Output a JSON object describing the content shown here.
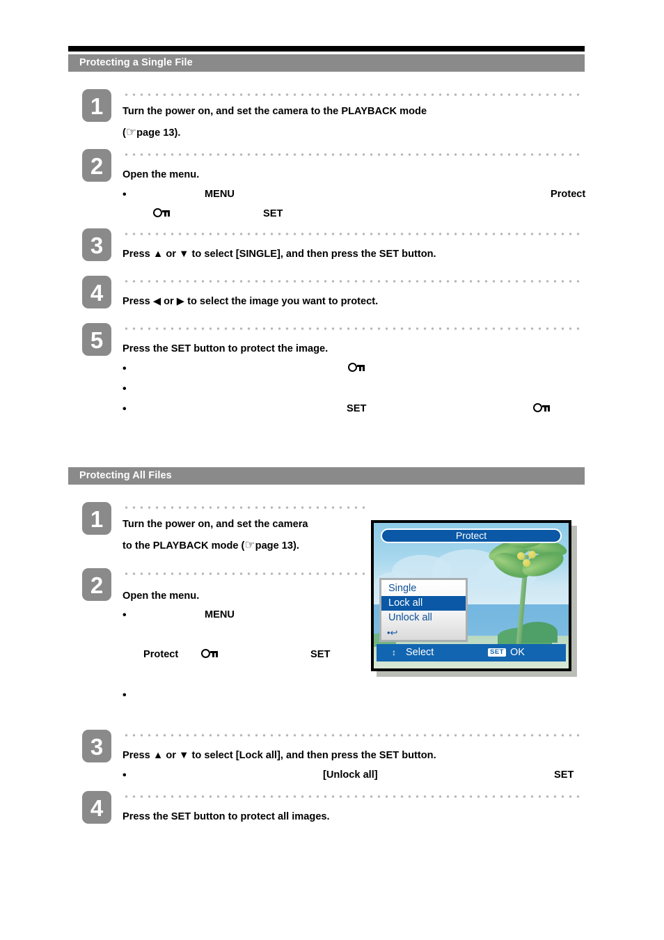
{
  "document": {
    "sections": [
      {
        "id": "single",
        "header": "Protecting a Single File",
        "has_black_rule": true,
        "steps": [
          {
            "number": "1",
            "lines": [
              "Turn the power on, and set the camera to the PLAYBACK mode",
              "page 13)."
            ],
            "line1": "Turn the power on, and set the camera to the PLAYBACK mode",
            "line2_prefix": "(",
            "line2_suffix": "page 13).",
            "bullets": []
          },
          {
            "number": "2",
            "line1": "Open the menu.",
            "bullets": [
              {
                "fragments": [
                  "MENU",
                  "Protect"
                ]
              },
              {
                "fragments": [
                  "SET"
                ]
              }
            ]
          },
          {
            "number": "3",
            "line1_a": "Press",
            "line1_b": "or",
            "line1_c": "to select [SINGLE], and then press the SET button.",
            "bullets": []
          },
          {
            "number": "4",
            "line1_a": "Press",
            "line1_b": "or",
            "line1_c": "to select the image you want to protect.",
            "bullets": []
          },
          {
            "number": "5",
            "line1": "Press the SET button to protect the image.",
            "bullets": [
              {
                "fragments": []
              },
              {
                "fragments": []
              },
              {
                "fragments": [
                  "SET"
                ]
              }
            ]
          }
        ]
      },
      {
        "id": "all",
        "header": "Protecting All Files",
        "has_black_rule": false,
        "steps": [
          {
            "number": "1",
            "line1": "Turn the power on, and set the camera",
            "line2_a": "to the PLAYBACK mode (",
            "line2_b": "page 13).",
            "bullets": []
          },
          {
            "number": "2",
            "line1": "Open the menu.",
            "bullets": [
              {
                "fragments": [
                  "MENU"
                ]
              },
              {
                "fragments": [
                  "Protect",
                  "SET"
                ]
              },
              {
                "fragments": []
              }
            ]
          },
          {
            "number": "3",
            "line1_a": "Press",
            "line1_b": "or",
            "line1_c": "to select [Lock all], and then press the SET button.",
            "bullets": [
              {
                "fragments": [
                  "[Unlock all]",
                  "SET"
                ]
              }
            ]
          },
          {
            "number": "4",
            "line1": "Press the SET button to protect all images.",
            "bullets": []
          }
        ]
      }
    ]
  },
  "lcd_screen": {
    "title": "Protect",
    "menu_items": [
      {
        "label": "Single",
        "selected": false
      },
      {
        "label": "Lock all",
        "selected": true
      },
      {
        "label": "Unlock all",
        "selected": false
      }
    ],
    "return_icon": "return-arrow-icon",
    "status_bar": {
      "arrows": "↕",
      "select_label": "Select",
      "set_badge": "SET",
      "ok_label": "OK"
    },
    "colors": {
      "title_pill": "#0a58a6",
      "highlight": "#0a58a6",
      "menu_text": "#10529c",
      "status_bar": "#1265b0",
      "sky": "#8ccae6",
      "sea": "#73b6df",
      "ground": "#b8d8c0"
    }
  },
  "icons": {
    "key": "key-icon",
    "hand": "☞",
    "up_triangle": "▲",
    "down_triangle": "▼",
    "left_triangle": "◀",
    "right_triangle": "▶",
    "bullet": "•"
  },
  "theme": {
    "header_bg": "#8a8a8a",
    "badge_bg": "#8a8a8a",
    "dot_color": "#b6b6b6",
    "text": "#000000"
  }
}
